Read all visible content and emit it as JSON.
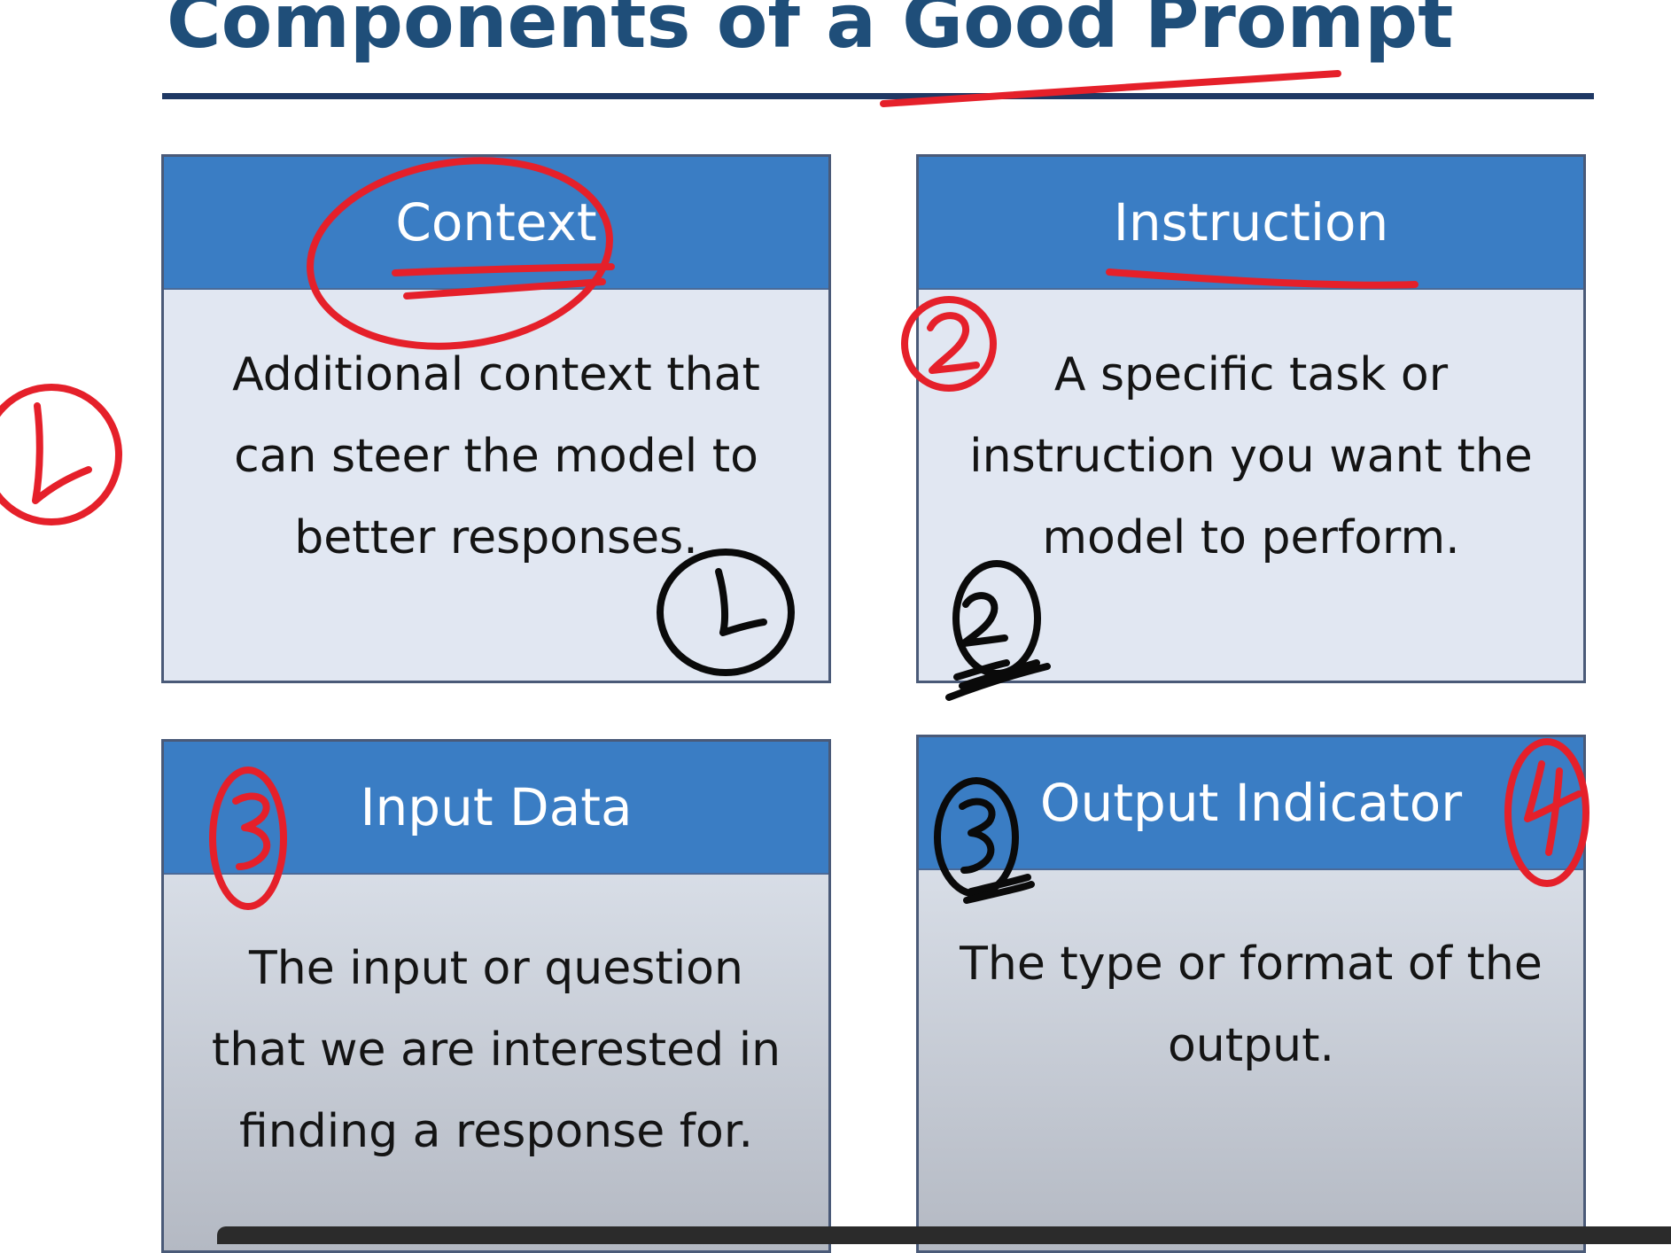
{
  "slide": {
    "title": "Components of a Good Prompt"
  },
  "cards": [
    {
      "heading": "Context",
      "body": "Additional context that\ncan steer the model to\nbetter responses."
    },
    {
      "heading": "Instruction",
      "body": "A specific task or\ninstruction you want the\nmodel to perform."
    },
    {
      "heading": "Input Data",
      "body": "The input or question\nthat we are interested in\nfinding a response for."
    },
    {
      "heading": "Output Indicator",
      "body": "The type or format of the\noutput."
    }
  ],
  "colors": {
    "title": "#1f4e79",
    "header_fill": "#3a7dc4",
    "annotation_red": "#e5202a",
    "annotation_black": "#0a0a0a"
  }
}
